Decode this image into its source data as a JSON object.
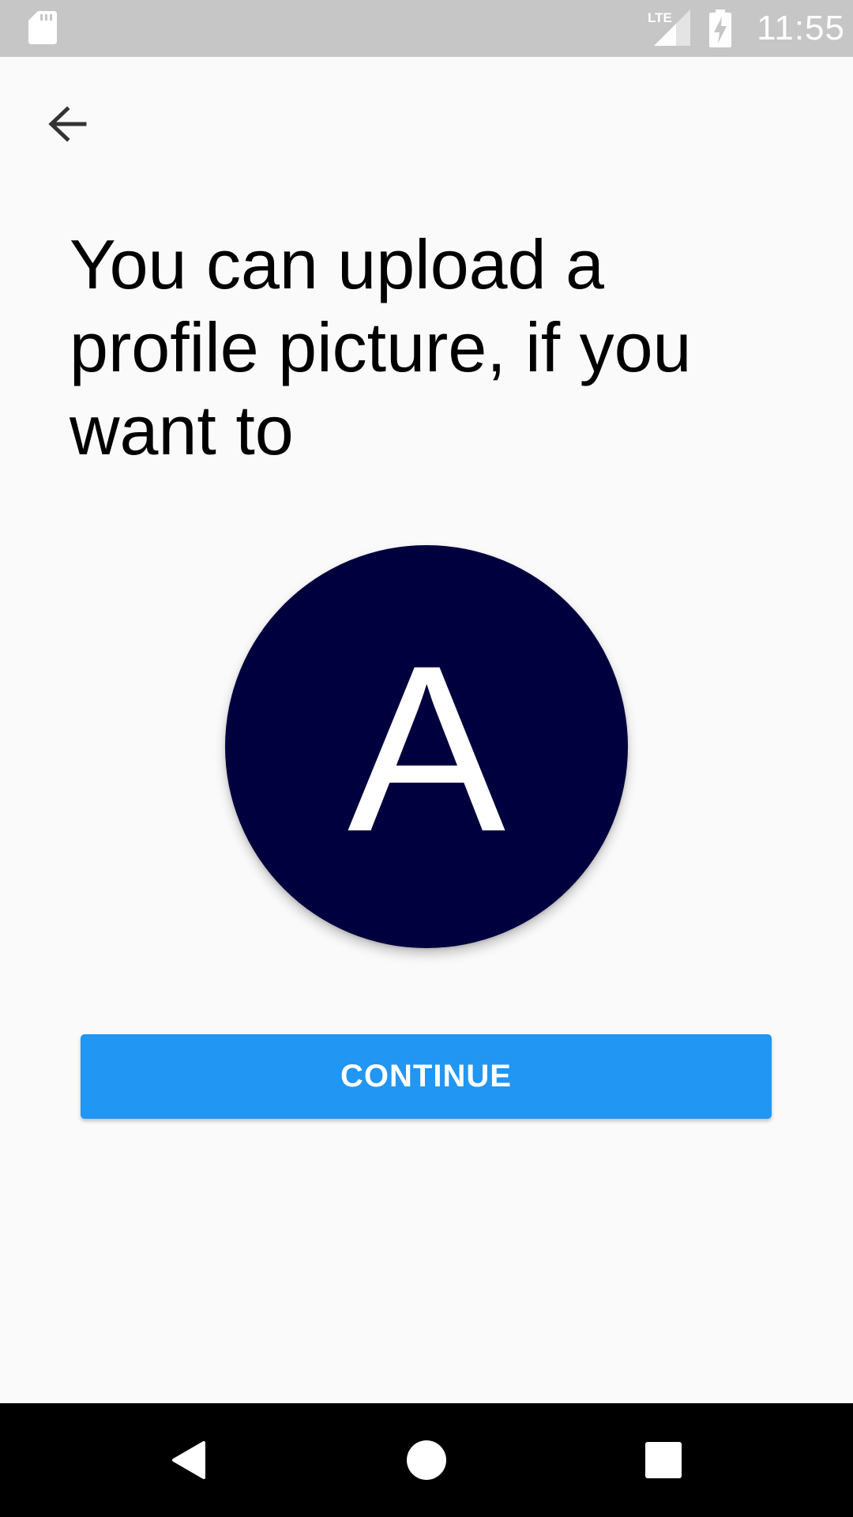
{
  "status_bar": {
    "time": "11:55",
    "network_label": "LTE",
    "icons": [
      "sd-card-icon",
      "lte-signal-icon",
      "battery-charging-icon"
    ]
  },
  "header": {
    "back_icon": "arrow-left-icon"
  },
  "main": {
    "heading": "You can upload a profile picture, if you want to",
    "avatar_initial": "A",
    "continue_label": "CONTINUE"
  },
  "nav_bar": {
    "icons": [
      "nav-back-icon",
      "nav-home-icon",
      "nav-recents-icon"
    ]
  },
  "colors": {
    "status_bar": "#c6c6c6",
    "background": "#fafafa",
    "avatar": "#00003f",
    "accent": "#2196f3",
    "nav_bar": "#000000"
  }
}
